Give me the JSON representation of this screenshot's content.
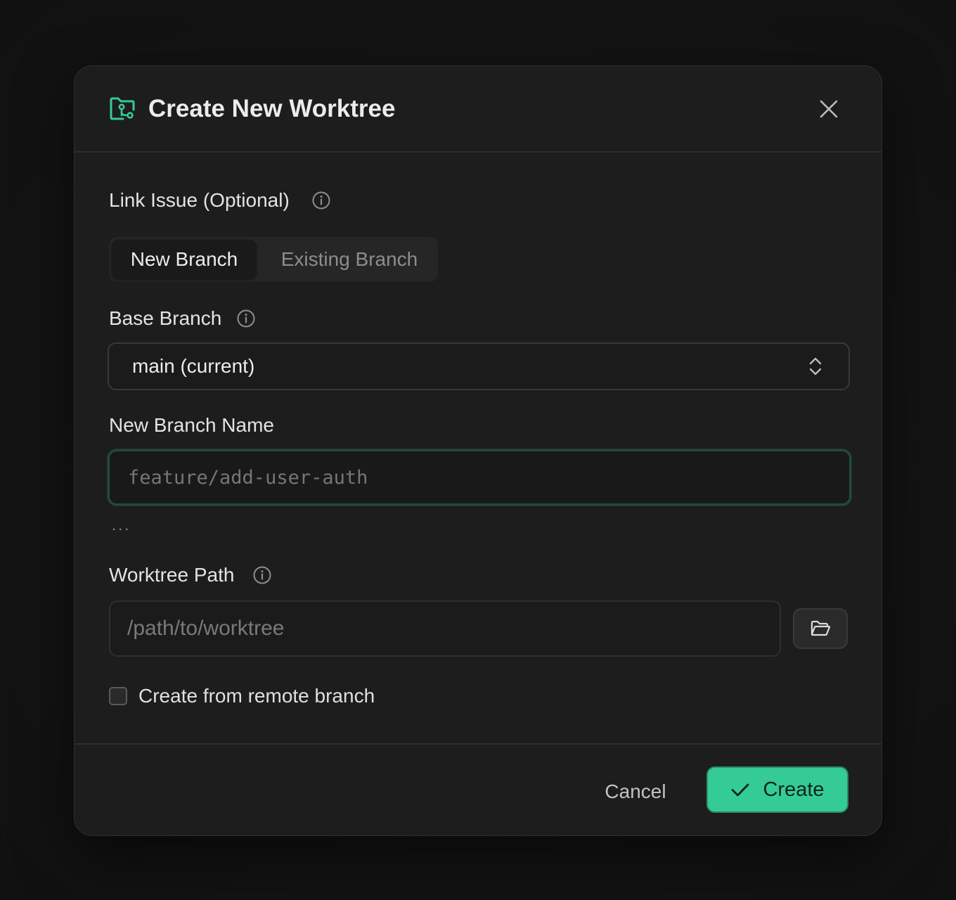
{
  "dialog": {
    "title": "Create New Worktree",
    "icon": "folder-git-icon",
    "close_icon": "close-icon"
  },
  "link_issue": {
    "label": "Link Issue (Optional)",
    "info_icon": "info-icon"
  },
  "branch_mode": {
    "options": [
      "New Branch",
      "Existing Branch"
    ],
    "selected": "New Branch"
  },
  "base_branch": {
    "label": "Base Branch",
    "info_icon": "info-icon",
    "value": "main (current)",
    "chevron_icon": "chevron-up-down-icon"
  },
  "new_branch_name": {
    "label": "New Branch Name",
    "value": "",
    "placeholder": "feature/add-user-auth",
    "hint": "..."
  },
  "worktree_path": {
    "label": "Worktree Path",
    "info_icon": "info-icon",
    "value": "",
    "placeholder": "/path/to/worktree",
    "browse_icon": "folder-open-icon"
  },
  "remote_branch": {
    "label": "Create from remote branch",
    "checked": false
  },
  "footer": {
    "cancel_label": "Cancel",
    "create_label": "Create",
    "create_icon": "check-icon"
  },
  "colors": {
    "accent": "#34cc94",
    "focus_border": "#244a3a",
    "dialog_bg": "#1d1d1d",
    "page_bg": "#121212"
  }
}
